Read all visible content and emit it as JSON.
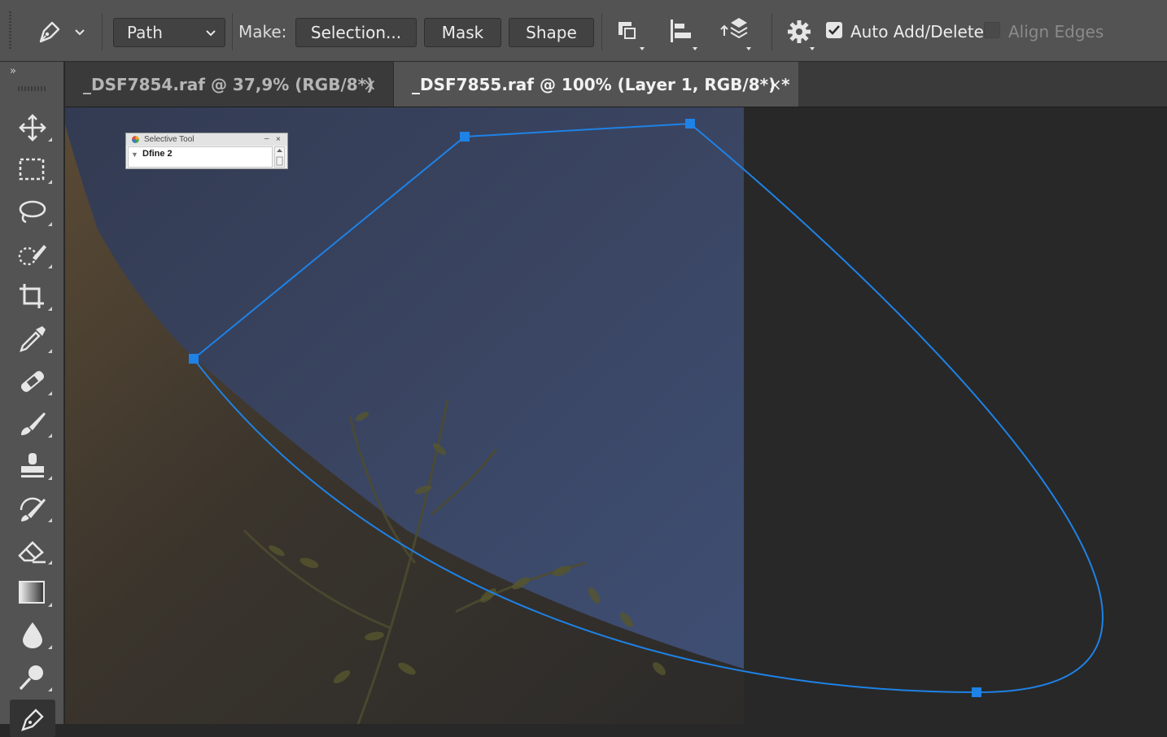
{
  "options_bar": {
    "mode_select": "Path",
    "make_label": "Make:",
    "buttons": {
      "selection": "Selection...",
      "mask": "Mask",
      "shape": "Shape"
    },
    "auto_add_delete": {
      "label": "Auto Add/Delete",
      "checked": true
    },
    "align_edges": {
      "label": "Align Edges",
      "checked": false
    }
  },
  "toolbar": {
    "collapse": "»",
    "tools": [
      "move-tool",
      "marquee-tool",
      "lasso-tool",
      "quick-selection-tool",
      "crop-tool",
      "eyedropper-tool",
      "healing-brush-tool",
      "brush-tool",
      "clone-stamp-tool",
      "history-brush-tool",
      "eraser-tool",
      "gradient-tool",
      "blur-tool",
      "dodge-tool",
      "pen-tool"
    ],
    "active_tool": "pen-tool"
  },
  "tabs": [
    {
      "title": "_DSF7854.raf @ 37,9% (RGB/8*)",
      "close": "×",
      "active": false
    },
    {
      "title": "_DSF7855.raf @ 100% (Layer 1, RGB/8*) *",
      "close": "×",
      "active": true
    }
  ],
  "floating_panel": {
    "title": "Selective Tool",
    "minimize": "–",
    "close": "×",
    "item": "Dfine 2"
  },
  "colors": {
    "ui_panel": "#535353",
    "tab_bar": "#3a3a3a",
    "canvas_bg": "#282828",
    "path_stroke": "#1e82e6",
    "sky": "#3b4763"
  }
}
